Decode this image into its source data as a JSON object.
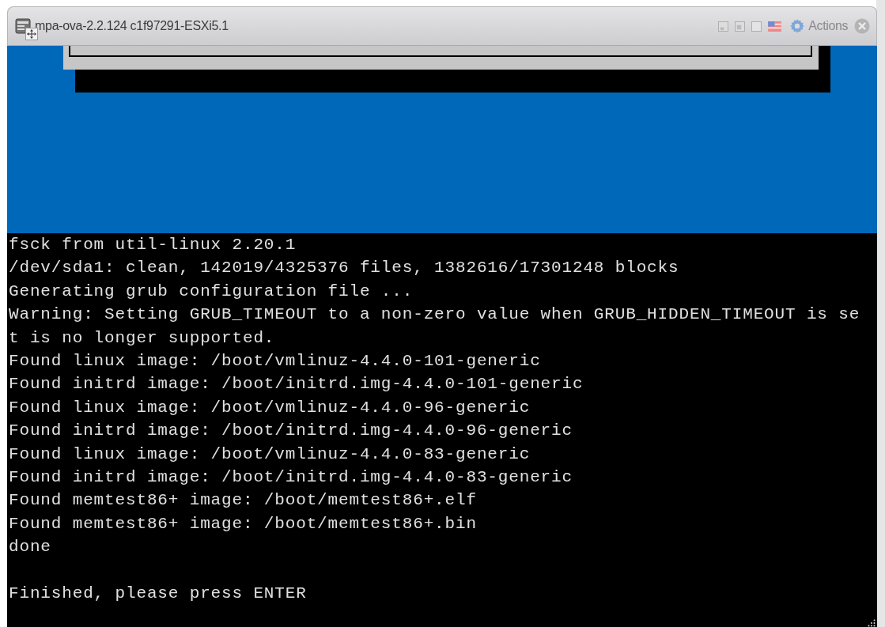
{
  "window": {
    "title": "mpa-ova-2.2.124 c1f97291-ESXi5.1",
    "actions_label": "Actions"
  },
  "console": {
    "lines": [
      "fsck from util-linux 2.20.1",
      "/dev/sda1: clean, 142019/4325376 files, 1382616/17301248 blocks",
      "Generating grub configuration file ...",
      "Warning: Setting GRUB_TIMEOUT to a non-zero value when GRUB_HIDDEN_TIMEOUT is se",
      "t is no longer supported.",
      "Found linux image: /boot/vmlinuz-4.4.0-101-generic",
      "Found initrd image: /boot/initrd.img-4.4.0-101-generic",
      "Found linux image: /boot/vmlinuz-4.4.0-96-generic",
      "Found initrd image: /boot/initrd.img-4.4.0-96-generic",
      "Found linux image: /boot/vmlinuz-4.4.0-83-generic",
      "Found initrd image: /boot/initrd.img-4.4.0-83-generic",
      "Found memtest86+ image: /boot/memtest86+.elf",
      "Found memtest86+ image: /boot/memtest86+.bin",
      "done"
    ],
    "prompt": "Finished, please press ENTER"
  }
}
